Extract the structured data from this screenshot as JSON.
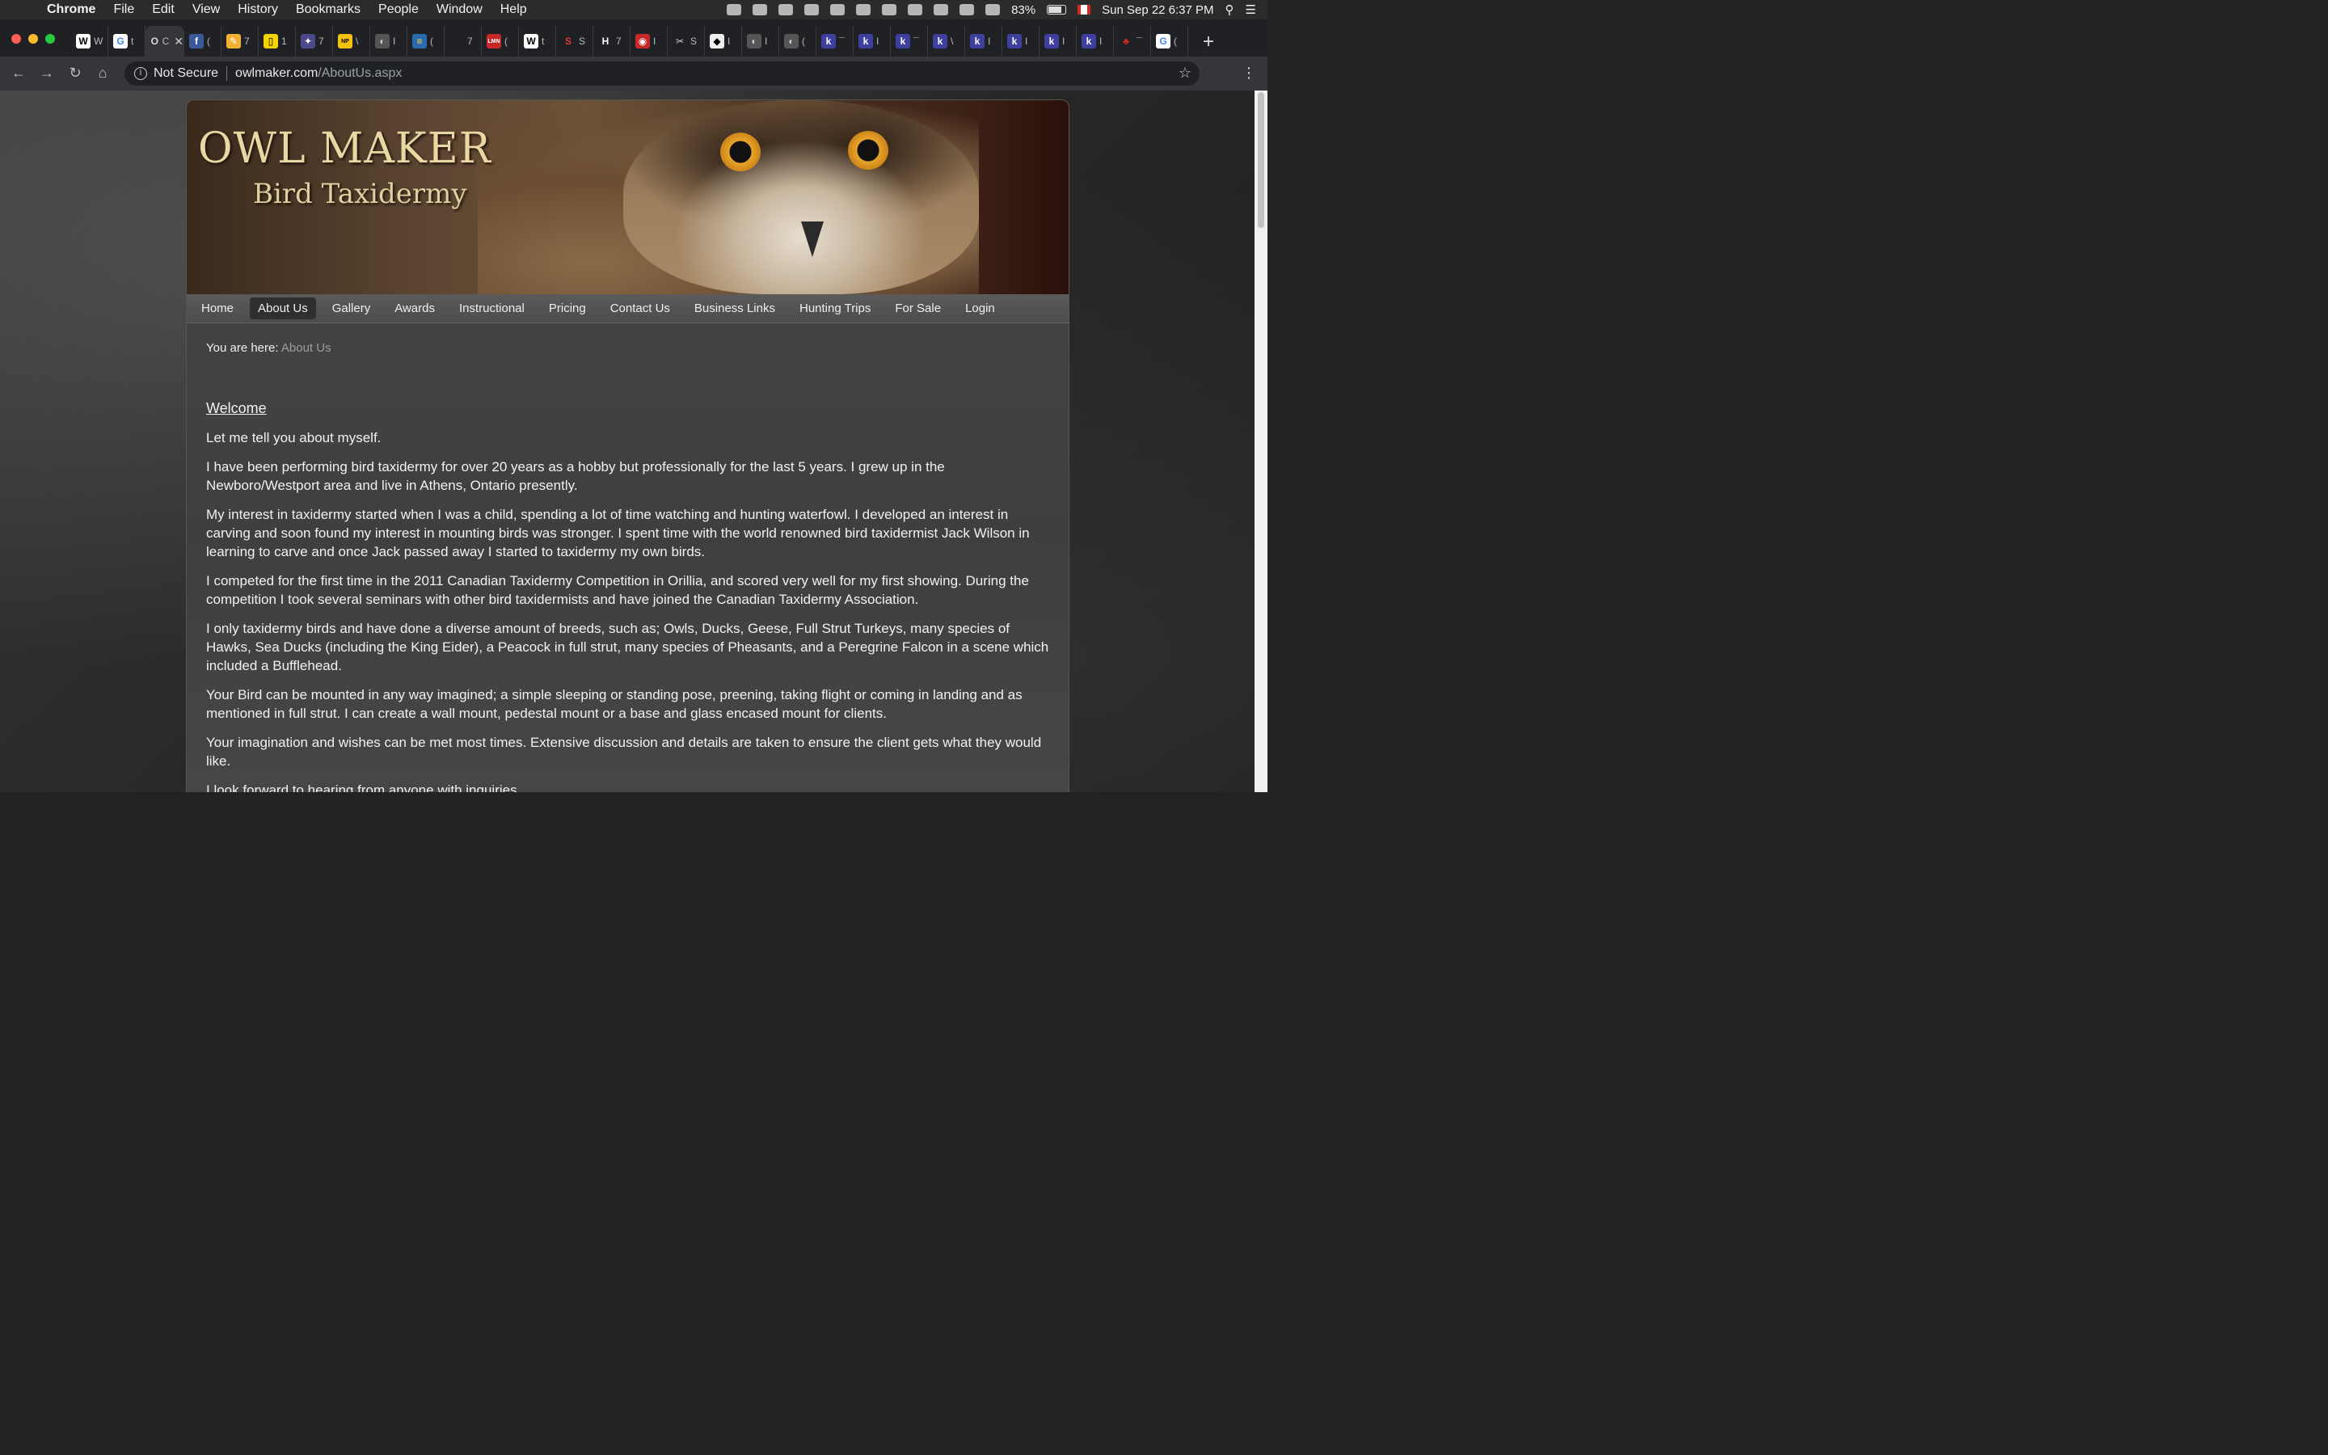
{
  "menubar": {
    "app": "Chrome",
    "items": [
      "File",
      "Edit",
      "View",
      "History",
      "Bookmarks",
      "People",
      "Window",
      "Help"
    ],
    "battery": "83%",
    "datetime": "Sun Sep 22  6:37 PM"
  },
  "tabs": [
    {
      "fav": "W",
      "color": "#ffffff",
      "fg": "#000000",
      "label": "W"
    },
    {
      "fav": "G",
      "color": "#ffffff",
      "fg": "#4285f4",
      "label": "t"
    },
    {
      "fav": "O",
      "color": "#35363a",
      "fg": "#dddddd",
      "label": "C"
    },
    {
      "fav": "f",
      "color": "#3b5998",
      "fg": "#ffffff",
      "label": "("
    },
    {
      "fav": "✎",
      "color": "#f2b134",
      "fg": "#ffffff",
      "label": "7"
    },
    {
      "fav": "▯",
      "color": "#f5d300",
      "fg": "#000000",
      "label": "1"
    },
    {
      "fav": "✦",
      "color": "#4a4a8a",
      "fg": "#ffffff",
      "label": "7"
    },
    {
      "fav": "NP",
      "color": "#f4c20d",
      "fg": "#000000",
      "label": "\\"
    },
    {
      "fav": "◐",
      "color": "#555555",
      "fg": "#cccccc",
      "label": "I"
    },
    {
      "fav": "≡",
      "color": "#2a6ab0",
      "fg": "#ffd54f",
      "label": "("
    },
    {
      "fav": "",
      "color": "#202124",
      "fg": "#cccccc",
      "label": "7"
    },
    {
      "fav": "LMN",
      "color": "#c62828",
      "fg": "#ffffff",
      "label": "("
    },
    {
      "fav": "W",
      "color": "#ffffff",
      "fg": "#000000",
      "label": "t"
    },
    {
      "fav": "S",
      "color": "#202124",
      "fg": "#e53935",
      "label": "S"
    },
    {
      "fav": "H",
      "color": "#202124",
      "fg": "#ffffff",
      "label": "7"
    },
    {
      "fav": "◉",
      "color": "#c62828",
      "fg": "#ffffff",
      "label": "I"
    },
    {
      "fav": "✂",
      "color": "#202124",
      "fg": "#cccccc",
      "label": "S"
    },
    {
      "fav": "◆",
      "color": "#eeeeee",
      "fg": "#000000",
      "label": "I"
    },
    {
      "fav": "◐",
      "color": "#555555",
      "fg": "#cccccc",
      "label": "I"
    },
    {
      "fav": "◐",
      "color": "#555555",
      "fg": "#cccccc",
      "label": "("
    },
    {
      "fav": "k",
      "color": "#3f3fa0",
      "fg": "#ffffff",
      "label": "¯"
    },
    {
      "fav": "k",
      "color": "#3f3fa0",
      "fg": "#ffffff",
      "label": "I"
    },
    {
      "fav": "k",
      "color": "#3f3fa0",
      "fg": "#ffffff",
      "label": "¯"
    },
    {
      "fav": "k",
      "color": "#3f3fa0",
      "fg": "#ffffff",
      "label": "\\"
    },
    {
      "fav": "k",
      "color": "#3f3fa0",
      "fg": "#ffffff",
      "label": "I"
    },
    {
      "fav": "k",
      "color": "#3f3fa0",
      "fg": "#ffffff",
      "label": "I"
    },
    {
      "fav": "k",
      "color": "#3f3fa0",
      "fg": "#ffffff",
      "label": "I"
    },
    {
      "fav": "k",
      "color": "#3f3fa0",
      "fg": "#ffffff",
      "label": "I"
    },
    {
      "fav": "♣",
      "color": "#202124",
      "fg": "#d52b1e",
      "label": "¯"
    },
    {
      "fav": "G",
      "color": "#ffffff",
      "fg": "#4285f4",
      "label": "("
    }
  ],
  "address": {
    "security": "Not Secure",
    "host": "owlmaker.com",
    "path": "/AboutUs.aspx"
  },
  "site": {
    "title": "OWL MAKER",
    "subtitle": "Bird Taxidermy",
    "nav": [
      "Home",
      "About Us",
      "Gallery",
      "Awards",
      "Instructional",
      "Pricing",
      "Contact Us",
      "Business Links",
      "Hunting Trips",
      "For Sale",
      "Login"
    ],
    "active_nav": "About Us",
    "breadcrumb_label": "You are here:",
    "breadcrumb_current": "About Us",
    "heading": "Welcome",
    "paragraphs": [
      "Let me tell you about myself.",
      "I have been performing bird taxidermy for over 20 years as a hobby but professionally for the last 5 years.  I grew up in the Newboro/Westport area and live in Athens, Ontario presently.",
      "My interest in taxidermy started when I was a child, spending a lot of time watching and hunting waterfowl.  I developed an interest in carving and soon found my interest in mounting birds was stronger.  I spent time with the world renowned bird taxidermist Jack Wilson in learning to carve and once Jack passed away I started to taxidermy my own birds.",
      "I competed for the first time in the 2011 Canadian Taxidermy Competition in Orillia, and scored very well for my first showing.  During the competition I took several seminars with other bird taxidermists and have joined the Canadian Taxidermy Association.",
      "I only taxidermy birds and have done a diverse amount of breeds, such as; Owls, Ducks, Geese, Full Strut Turkeys, many species of Hawks, Sea Ducks (including the King Eider), a Peacock in full strut, many species of Pheasants, and a Peregrine Falcon in a scene which included a Bufflehead.",
      "Your Bird can be mounted in any way imagined; a simple sleeping or standing pose, preening, taking flight or coming in landing and as mentioned in full strut.  I can create a wall mount, pedestal mount or a base and glass encased mount for clients.",
      "Your imagination and wishes can be met most times.  Extensive discussion and details are taken to ensure the client gets what they would like.",
      "I look forward to hearing from anyone with inquiries."
    ]
  }
}
